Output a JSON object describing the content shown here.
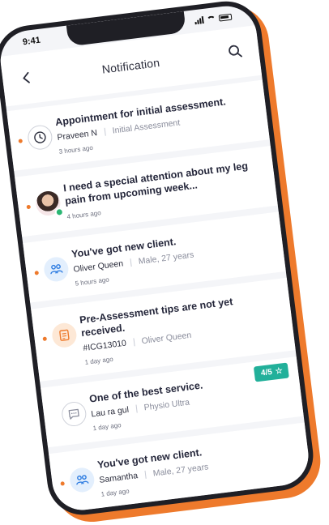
{
  "status_bar": {
    "time": "9:41"
  },
  "header": {
    "title": "Notification",
    "back_icon": "chevron-left-icon",
    "search_icon": "search-icon"
  },
  "notifications": [
    {
      "title": "Appointment for initial assessment.",
      "who": "Praveen N",
      "detail": "Initial Assessment",
      "time": "3 hours ago",
      "icon": "clock-icon",
      "unread": true
    },
    {
      "title": "I need a special attention about my leg pain from upcoming week...",
      "who": "",
      "detail": "",
      "time": "4 hours ago",
      "icon": "user-avatar",
      "unread": true,
      "online": true
    },
    {
      "title": "You've got new client.",
      "who": "Oliver Queen",
      "detail": "Male, 27 years",
      "time": "5 hours ago",
      "icon": "users-icon",
      "unread": true
    },
    {
      "title": "Pre-Assessment tips are not yet received.",
      "who": "#ICG13010",
      "detail": "Oliver Queen",
      "time": "1 day ago",
      "icon": "clipboard-icon",
      "unread": true
    },
    {
      "title": "One of the best service.",
      "who": "Lau ra gul",
      "detail": "Physio Ultra",
      "time": "1 day ago",
      "icon": "chat-icon",
      "unread": false,
      "rating": "4/5"
    },
    {
      "title": "You've got new client.",
      "who": "Samantha",
      "detail": "Male, 27 years",
      "time": "1 day ago",
      "icon": "users-icon",
      "unread": true
    }
  ],
  "colors": {
    "accent": "#ee7a2c",
    "rating": "#22b09a",
    "online": "#2bb673",
    "icon_blue": "#2f7de1"
  }
}
